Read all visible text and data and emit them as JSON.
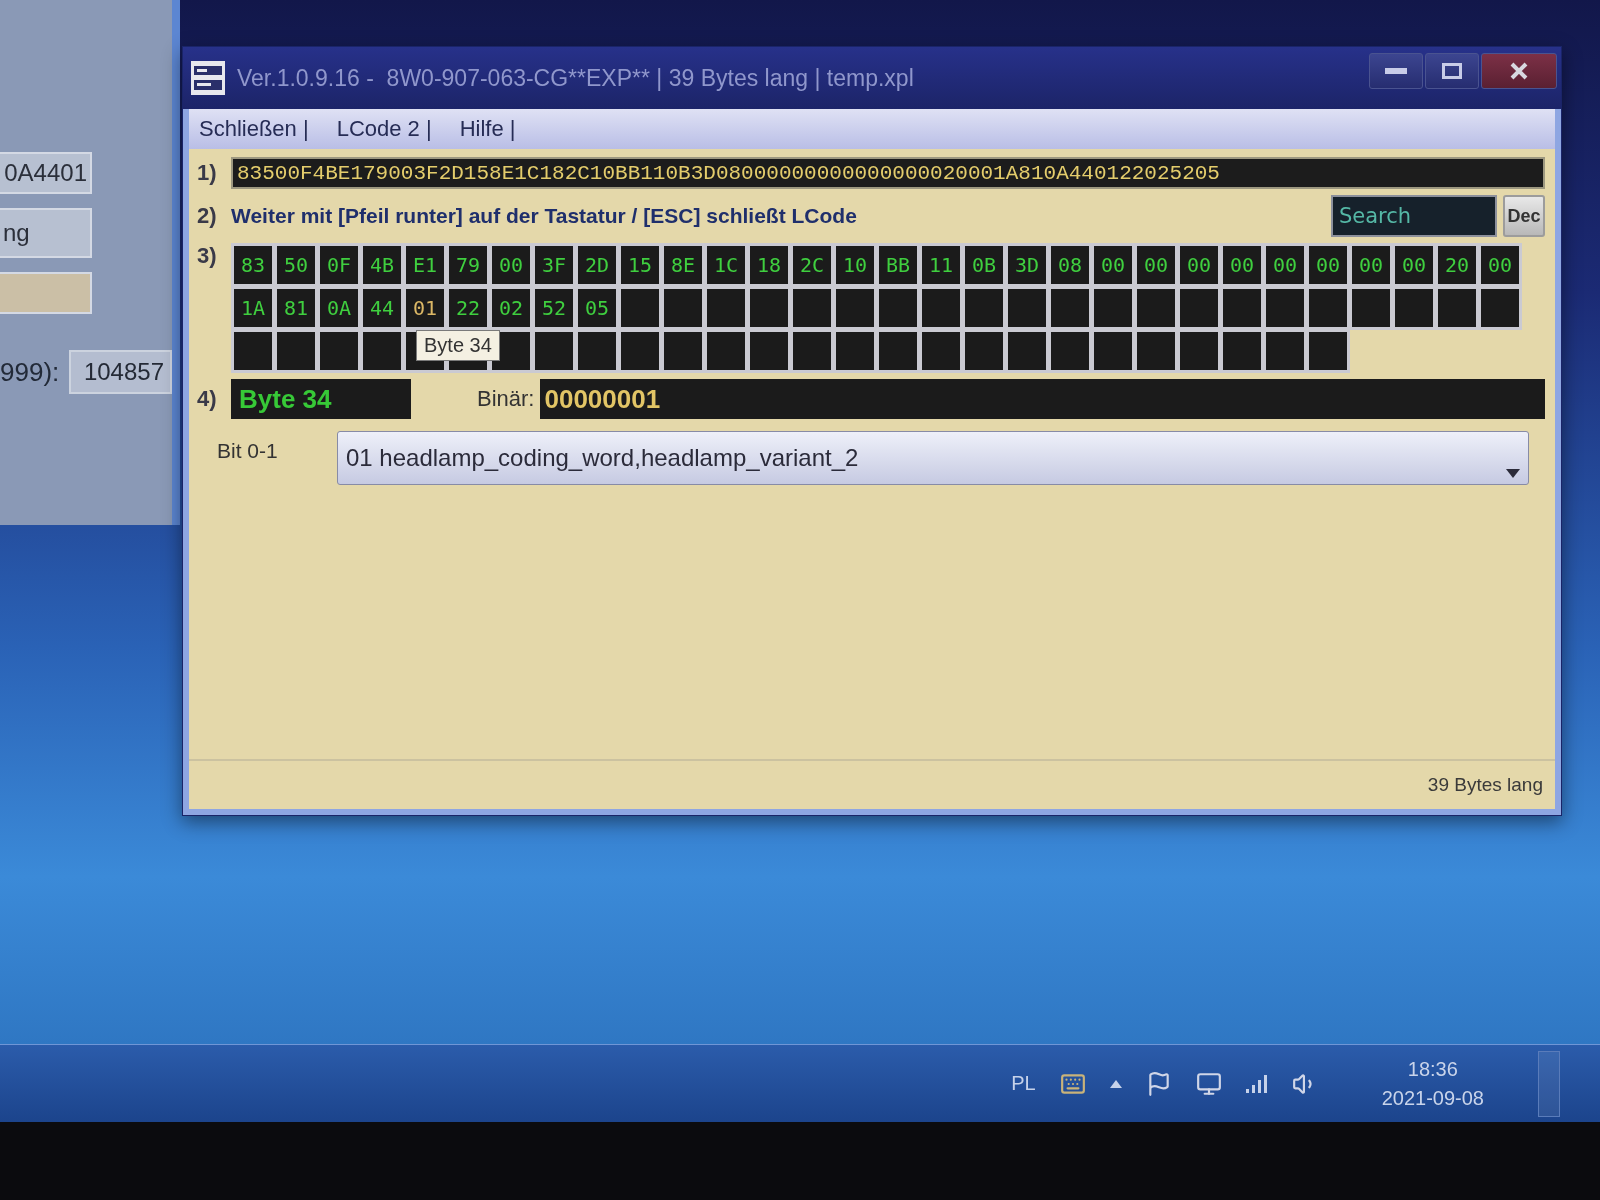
{
  "background_window": {
    "fields": [
      {
        "kind": "text",
        "value": "0A4401"
      },
      {
        "kind": "tall",
        "value": "ng"
      },
      {
        "kind": "blank"
      }
    ],
    "counter": {
      "label": "999):",
      "value": "104857"
    }
  },
  "window": {
    "title": "Ver.1.0.9.16 -  8W0-907-063-CG**EXP** | 39 Bytes lang | temp.xpl",
    "menu": [
      "Schließen |",
      "LCode 2 |",
      "Hilfe |"
    ]
  },
  "hex_row": {
    "label": "1)",
    "value": "83500F4BE179003F2D158E1C182C10BB110B3D08000000000000000020001A810A440122025205"
  },
  "instruction_row": {
    "label": "2)",
    "text": "Weiter mit [Pfeil runter] auf der Tastatur / [ESC] schließt LCode",
    "search": {
      "placeholder": "Search"
    },
    "mode_button": "Dec"
  },
  "bytes": {
    "label": "3)",
    "tooltip": "Byte 34",
    "cells": [
      {
        "kind": "byte",
        "value": "83",
        "selected": false
      },
      {
        "kind": "byte",
        "value": "50",
        "selected": false
      },
      {
        "kind": "byte",
        "value": "0F",
        "selected": false
      },
      {
        "kind": "byte",
        "value": "4B",
        "selected": false
      },
      {
        "kind": "byte",
        "value": "E1",
        "selected": false
      },
      {
        "kind": "byte",
        "value": "79",
        "selected": false
      },
      {
        "kind": "byte",
        "value": "00",
        "selected": false
      },
      {
        "kind": "byte",
        "value": "3F",
        "selected": false
      },
      {
        "kind": "byte",
        "value": "2D",
        "selected": false
      },
      {
        "kind": "byte",
        "value": "15",
        "selected": false
      },
      {
        "kind": "byte",
        "value": "8E",
        "selected": false
      },
      {
        "kind": "byte",
        "value": "1C",
        "selected": false
      },
      {
        "kind": "byte",
        "value": "18",
        "selected": false
      },
      {
        "kind": "byte",
        "value": "2C",
        "selected": false
      },
      {
        "kind": "byte",
        "value": "10",
        "selected": false
      },
      {
        "kind": "byte",
        "value": "BB",
        "selected": false
      },
      {
        "kind": "byte",
        "value": "11",
        "selected": false
      },
      {
        "kind": "byte",
        "value": "0B",
        "selected": false
      },
      {
        "kind": "byte",
        "value": "3D",
        "selected": false
      },
      {
        "kind": "byte",
        "value": "08",
        "selected": false
      },
      {
        "kind": "byte",
        "value": "00",
        "selected": false
      },
      {
        "kind": "byte",
        "value": "00",
        "selected": false
      },
      {
        "kind": "byte",
        "value": "00",
        "selected": false
      },
      {
        "kind": "byte",
        "value": "00",
        "selected": false
      },
      {
        "kind": "byte",
        "value": "00",
        "selected": false
      },
      {
        "kind": "byte",
        "value": "00",
        "selected": false
      },
      {
        "kind": "byte",
        "value": "00",
        "selected": false
      },
      {
        "kind": "byte",
        "value": "00",
        "selected": false
      },
      {
        "kind": "byte",
        "value": "20",
        "selected": false
      },
      {
        "kind": "byte",
        "value": "00",
        "selected": false
      },
      {
        "kind": "byte",
        "value": "1A",
        "selected": false
      },
      {
        "kind": "byte",
        "value": "81",
        "selected": false
      },
      {
        "kind": "byte",
        "value": "0A",
        "selected": false
      },
      {
        "kind": "byte",
        "value": "44",
        "selected": false
      },
      {
        "kind": "byte",
        "value": "01",
        "selected": true
      },
      {
        "kind": "byte",
        "value": "22",
        "selected": false
      },
      {
        "kind": "byte",
        "value": "02",
        "selected": false
      },
      {
        "kind": "byte",
        "value": "52",
        "selected": false
      },
      {
        "kind": "byte",
        "value": "05",
        "selected": false
      },
      {
        "kind": "empty",
        "selected": false
      },
      {
        "kind": "empty",
        "selected": false
      },
      {
        "kind": "empty",
        "selected": false
      },
      {
        "kind": "empty",
        "selected": false
      },
      {
        "kind": "empty",
        "selected": false
      },
      {
        "kind": "empty",
        "selected": false
      },
      {
        "kind": "empty",
        "selected": false
      },
      {
        "kind": "empty",
        "selected": false
      },
      {
        "kind": "empty",
        "selected": false
      },
      {
        "kind": "empty",
        "selected": false
      },
      {
        "kind": "empty",
        "selected": false
      },
      {
        "kind": "empty",
        "selected": false
      },
      {
        "kind": "empty",
        "selected": false
      },
      {
        "kind": "empty",
        "selected": false
      },
      {
        "kind": "empty",
        "selected": false
      },
      {
        "kind": "empty",
        "selected": false
      },
      {
        "kind": "empty",
        "selected": false
      },
      {
        "kind": "empty",
        "selected": false
      },
      {
        "kind": "empty",
        "selected": false
      },
      {
        "kind": "empty",
        "selected": false
      },
      {
        "kind": "empty",
        "selected": false
      },
      {
        "kind": "empty",
        "selected": false
      },
      {
        "kind": "empty",
        "selected": false
      },
      {
        "kind": "empty",
        "selected": false
      },
      {
        "kind": "empty",
        "selected": false
      },
      {
        "kind": "empty",
        "selected": false
      },
      {
        "kind": "empty",
        "selected": false
      },
      {
        "kind": "empty",
        "selected": false
      },
      {
        "kind": "empty",
        "selected": false
      },
      {
        "kind": "empty",
        "selected": false
      },
      {
        "kind": "empty",
        "selected": false
      },
      {
        "kind": "empty",
        "selected": false
      },
      {
        "kind": "empty",
        "selected": false
      },
      {
        "kind": "empty",
        "selected": false
      },
      {
        "kind": "empty",
        "selected": false
      },
      {
        "kind": "empty",
        "selected": false
      },
      {
        "kind": "empty",
        "selected": false
      },
      {
        "kind": "empty",
        "selected": false
      },
      {
        "kind": "empty",
        "selected": false
      },
      {
        "kind": "empty",
        "selected": false
      },
      {
        "kind": "empty",
        "selected": false
      },
      {
        "kind": "empty",
        "selected": false
      },
      {
        "kind": "empty",
        "selected": false
      },
      {
        "kind": "empty",
        "selected": false
      },
      {
        "kind": "empty",
        "selected": false
      },
      {
        "kind": "empty",
        "selected": false
      },
      {
        "kind": "empty",
        "selected": false
      }
    ]
  },
  "byte_info": {
    "label": "4)",
    "byte": "Byte 34",
    "binary_label": "Binär:",
    "binary": "00000001"
  },
  "bit_field": {
    "label": "Bit 0-1",
    "value": "01 headlamp_coding_word,headlamp_variant_2"
  },
  "status_bar": {
    "text": "39 Bytes lang"
  },
  "taskbar": {
    "language": "PL",
    "time": "18:36",
    "date": "2021-09-08"
  }
}
